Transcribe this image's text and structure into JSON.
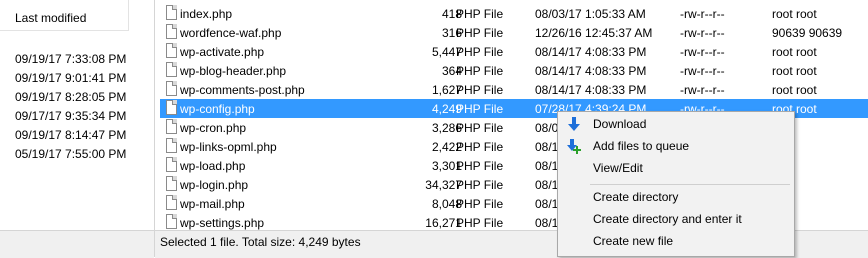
{
  "left_pane": {
    "header": "Last modified",
    "dates": [
      "09/19/17 7:33:08 PM",
      "09/19/17 9:01:41 PM",
      "09/19/17 8:28:05 PM",
      "09/17/17 9:35:34 PM",
      "09/19/17 8:14:47 PM",
      "05/19/17 7:55:00 PM"
    ]
  },
  "files": [
    {
      "name": "index.php",
      "size": "418",
      "type": "PHP File",
      "modified": "08/03/17 1:05:33 AM",
      "perms": "-rw-r--r--",
      "owner": "root root"
    },
    {
      "name": "wordfence-waf.php",
      "size": "316",
      "type": "PHP File",
      "modified": "12/26/16 12:45:37 AM",
      "perms": "-rw-r--r--",
      "owner": "90639 90639"
    },
    {
      "name": "wp-activate.php",
      "size": "5,447",
      "type": "PHP File",
      "modified": "08/14/17 4:08:33 PM",
      "perms": "-rw-r--r--",
      "owner": "root root"
    },
    {
      "name": "wp-blog-header.php",
      "size": "364",
      "type": "PHP File",
      "modified": "08/14/17 4:08:33 PM",
      "perms": "-rw-r--r--",
      "owner": "root root"
    },
    {
      "name": "wp-comments-post.php",
      "size": "1,627",
      "type": "PHP File",
      "modified": "08/14/17 4:08:33 PM",
      "perms": "-rw-r--r--",
      "owner": "root root"
    },
    {
      "name": "wp-config.php",
      "size": "4,249",
      "type": "PHP File",
      "modified": "07/28/17 4:39:24 PM",
      "perms": "-rw-r--r--",
      "owner": "root root"
    },
    {
      "name": "wp-cron.php",
      "size": "3,286",
      "type": "PHP File",
      "modified": "08/0",
      "perms": "",
      "owner": ""
    },
    {
      "name": "wp-links-opml.php",
      "size": "2,422",
      "type": "PHP File",
      "modified": "08/1",
      "perms": "",
      "owner": ""
    },
    {
      "name": "wp-load.php",
      "size": "3,301",
      "type": "PHP File",
      "modified": "08/1",
      "perms": "",
      "owner": ""
    },
    {
      "name": "wp-login.php",
      "size": "34,327",
      "type": "PHP File",
      "modified": "08/1",
      "perms": "",
      "owner": ""
    },
    {
      "name": "wp-mail.php",
      "size": "8,048",
      "type": "PHP File",
      "modified": "08/1",
      "perms": "",
      "owner": ""
    },
    {
      "name": "wp-settings.php",
      "size": "16,271",
      "type": "PHP File",
      "modified": "08/1",
      "perms": "",
      "owner": ""
    }
  ],
  "selected_index": 5,
  "status": "Selected 1 file. Total size: 4,249 bytes",
  "context_menu": {
    "items": [
      "Download",
      "Add files to queue",
      "View/Edit",
      "Create directory",
      "Create directory and enter it",
      "Create new file"
    ],
    "icons": [
      "download-arrow-icon",
      "add-to-queue-icon"
    ]
  },
  "colors": {
    "selection": "#3399ff",
    "download_icon": "#1e6fd9",
    "queue_plus": "#2aa02a"
  }
}
